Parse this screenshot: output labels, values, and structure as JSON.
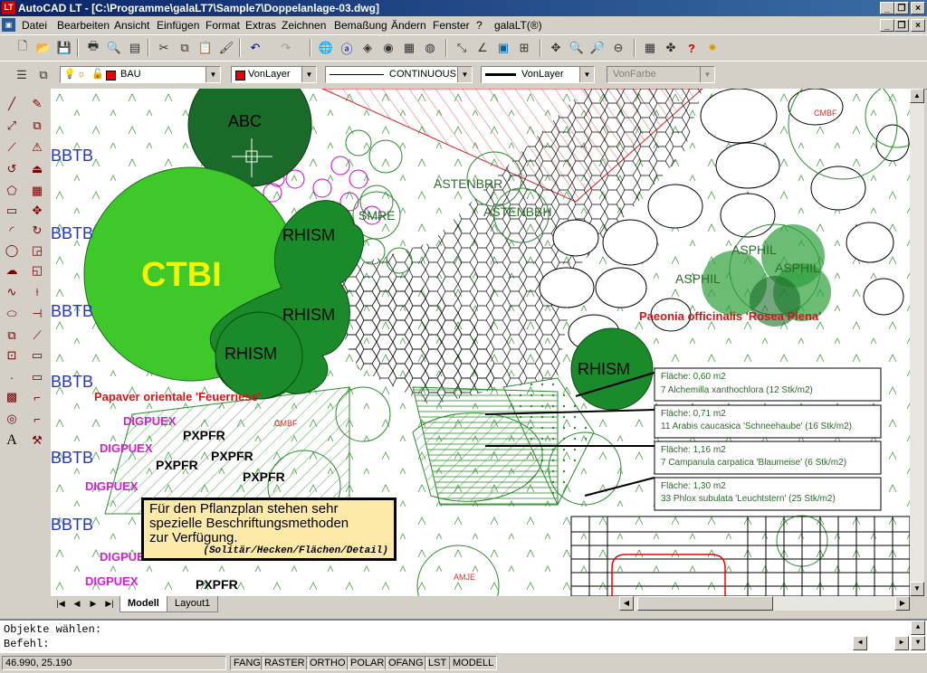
{
  "window": {
    "title": "AutoCAD LT - [C:\\Programme\\galaLT7\\Sample7\\Doppelanlage-03.dwg]",
    "app_icon": "LT"
  },
  "menubar": [
    "Datei",
    "Bearbeiten",
    "Ansicht",
    "Einfügen",
    "Format",
    "Extras",
    "Zeichnen",
    "Bemaßung",
    "Ändern",
    "Fenster",
    "?",
    "galaLT(®)"
  ],
  "layers": {
    "layer": "BAU",
    "color": "VonLayer",
    "linetype": "CONTINUOUS",
    "lineweight": "VonLayer",
    "plotstyle": "VonFarbe"
  },
  "drawing": {
    "labels_green": [
      "ABC",
      "RHISM",
      "RHISM",
      "RHISM",
      "RHISM",
      "SMRE",
      "ASTENBRR",
      "ASTENBBH",
      "ASPHIL",
      "ASPHIL",
      "ASPHIL"
    ],
    "ctbi": "CTBI",
    "bbtb": "BBTB",
    "cmbf": "CMBF",
    "amje": "AMJE",
    "papaver": "Papaver orientale 'Feuerriese'",
    "paeonia": "Paeonia officinalis 'Rosea Plena'",
    "digpuex": "DIGPUEX",
    "pxpfr": "PXPFR",
    "tooltip": {
      "line1": "Für den Pflanzplan stehen sehr",
      "line2": "spezielle Beschriftungsmethoden",
      "line3": "zur Verfügung.",
      "note": "(Solitär/Hecken/Flächen/Detail)"
    },
    "areas": [
      {
        "area": "Fläche: 0,60 m2",
        "plant": "7  Alchemilla xanthochlora (12 Stk/m2)"
      },
      {
        "area": "Fläche: 0,71 m2",
        "plant": "11  Arabis caucasica 'Schneehaube' (16 Stk/m2)"
      },
      {
        "area": "Fläche: 1,16 m2",
        "plant": "7  Campanula carpatica 'Blaumeise' (6 Stk/m2)"
      },
      {
        "area": "Fläche: 1,30 m2",
        "plant": "33  Phlox subulata 'Leuchtstern' (25 Stk/m2)"
      }
    ]
  },
  "tabs": [
    "Modell",
    "Layout1"
  ],
  "command": {
    "line1": "Objekte wählen:",
    "line2": "Befehl:"
  },
  "status": {
    "coords": "46.990, 25.190",
    "toggles": [
      "FANG",
      "RASTER",
      "ORTHO",
      "POLAR",
      "OFANG",
      "LST",
      "MODELL"
    ]
  }
}
